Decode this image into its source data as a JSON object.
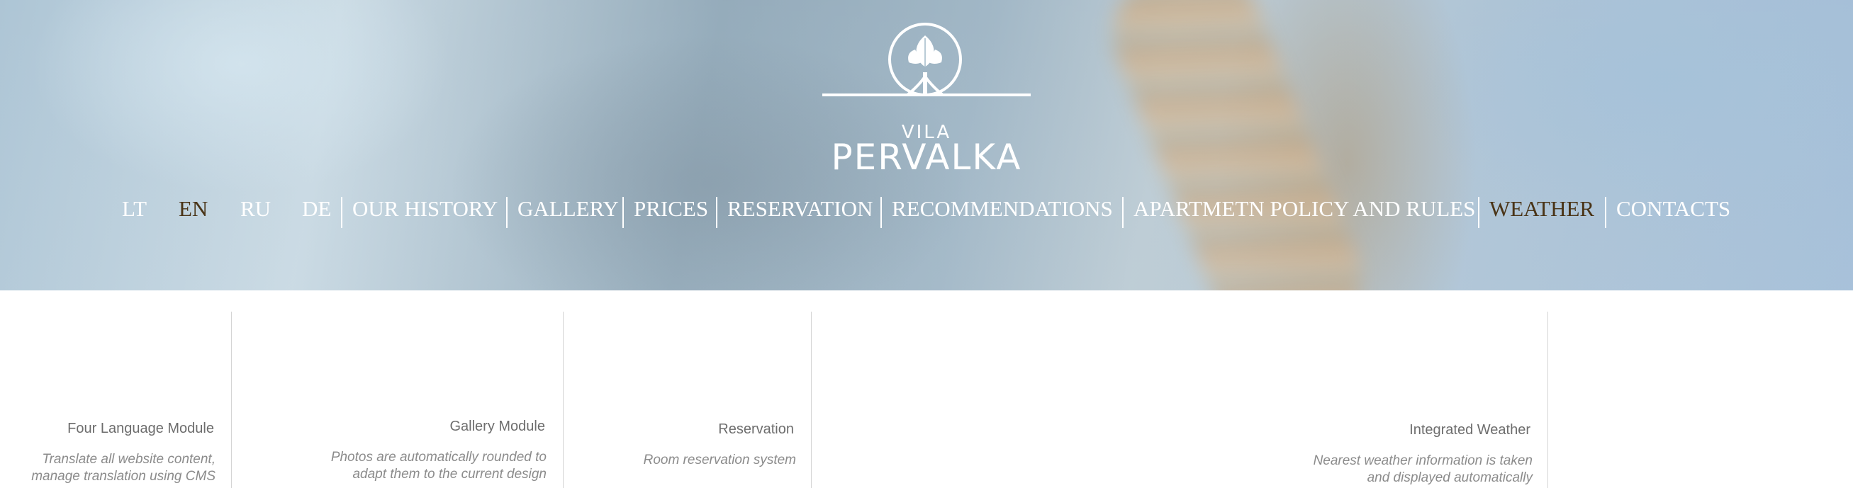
{
  "logo": {
    "small_text": "VILA",
    "large_text": "PERVALKA"
  },
  "languages": [
    "LT",
    "EN",
    "RU",
    "DE"
  ],
  "active_language": "EN",
  "nav": {
    "items": [
      "OUR HISTORY",
      "GALLERY",
      "PRICES",
      "RESERVATION",
      "RECOMMENDATIONS",
      "APARTMETN POLICY AND RULES",
      "WEATHER",
      "CONTACTS"
    ],
    "active": "WEATHER"
  },
  "colors": {
    "nav_text": "#ffffff",
    "nav_active": "#4a3417",
    "feature_title": "#6d6d6d",
    "feature_desc": "#8b8b8b"
  },
  "features": [
    {
      "title": "Four Language Module",
      "desc_line1": "Translate all website content,",
      "desc_line2": "manage translation using CMS"
    },
    {
      "title": "Gallery Module",
      "desc_line1": "Photos are automatically rounded to",
      "desc_line2": "adapt them to the current design"
    },
    {
      "title": "Reservation",
      "desc_line1": "Room reservation system",
      "desc_line2": ""
    },
    {
      "title": "Integrated Weather",
      "desc_line1": "Nearest weather information is taken",
      "desc_line2": "and displayed automatically"
    }
  ]
}
